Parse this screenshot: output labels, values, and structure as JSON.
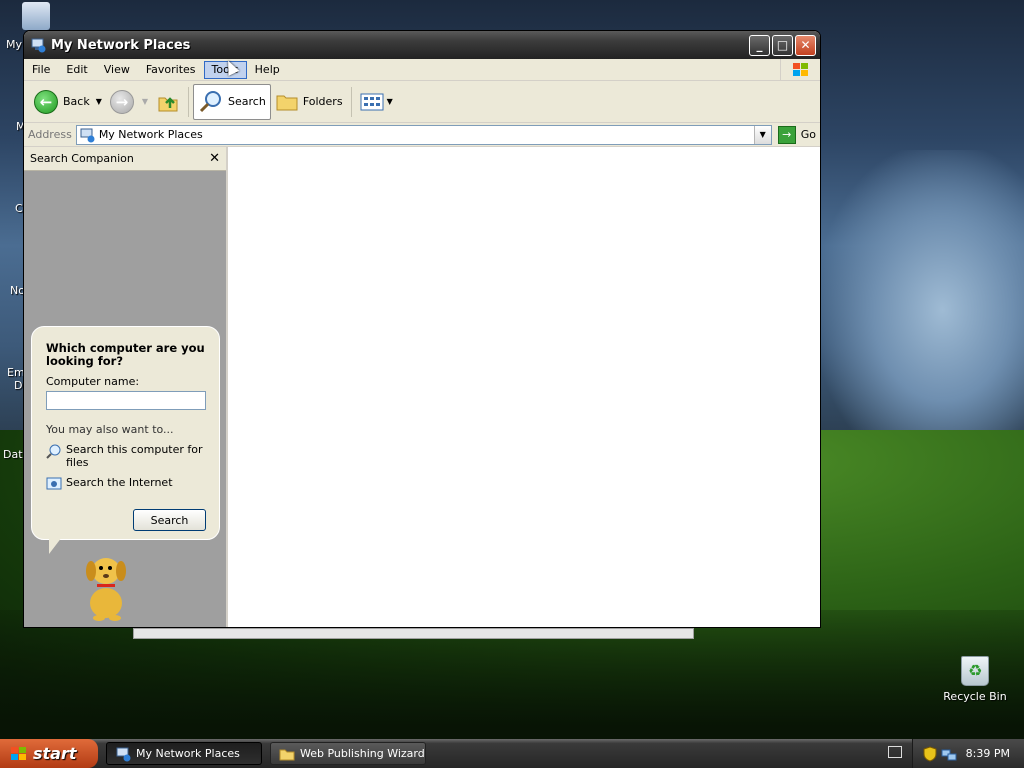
{
  "desktop": {
    "labels": [
      "My",
      "M",
      "C",
      "No",
      "Em",
      "D",
      "Data"
    ],
    "recycle_bin": "Recycle Bin"
  },
  "window": {
    "title": "My Network Places",
    "menu": [
      "File",
      "Edit",
      "View",
      "Favorites",
      "Tools",
      "Help"
    ],
    "toolbar": {
      "back": "Back",
      "search": "Search",
      "folders": "Folders"
    },
    "address": {
      "label": "Address",
      "value": "My Network Places",
      "go": "Go"
    }
  },
  "search_companion": {
    "title": "Search Companion",
    "question": "Which computer are you looking for?",
    "computer_name_label": "Computer name:",
    "computer_name_value": "",
    "also_label": "You may also want to...",
    "links": [
      "Search this computer for files",
      "Search the Internet"
    ],
    "search_button": "Search"
  },
  "taskbar": {
    "start": "start",
    "tasks": [
      "My Network Places",
      "Web Publishing Wizard"
    ],
    "clock": "8:39 PM"
  }
}
